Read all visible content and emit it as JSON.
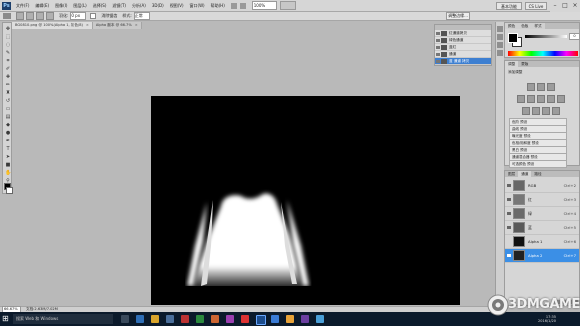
{
  "menubar": {
    "items": [
      "文件(F)",
      "编辑(E)",
      "图像(I)",
      "图层(L)",
      "选择(S)",
      "滤镜(T)",
      "分析(A)",
      "3D(D)",
      "视图(V)",
      "窗口(W)",
      "帮助(H)"
    ],
    "zoom": "100%",
    "workspace_button": "基本功能",
    "cs_live": "CS Live"
  },
  "options": {
    "feather_label": "羽化:",
    "feather_value": "0 px",
    "antialias_label": "消除锯齿",
    "style_label": "样式:",
    "style_value": "正常",
    "refine_button": "调整边缘..."
  },
  "tabs": [
    {
      "label": "BG0810.png @ 100%(Alpha 1, 灰色/8)",
      "close": "×"
    },
    {
      "label": "Alpha 副本 @ 66.7%",
      "close": "×"
    }
  ],
  "status": {
    "zoom": "66.67%",
    "doc": "文档:2.63M/7.02M"
  },
  "channels": {
    "rows": [
      {
        "label": "红通道拷贝"
      },
      {
        "label": "绿色通道"
      },
      {
        "label": "蓝红"
      },
      {
        "label": "通道"
      },
      {
        "label": "蓝 通道 拷贝"
      }
    ]
  },
  "color_panel": {
    "tabs": [
      "颜色",
      "色板",
      "样式"
    ],
    "value": "0"
  },
  "adjustments": {
    "tabs": [
      "调整",
      "蒙版"
    ],
    "title": "添加调整",
    "presets": [
      "色阶 预设",
      "曲线 预设",
      "曝光度 预设",
      "色相/饱和度 预设",
      "黑白 预设",
      "通道混合器 预设",
      "可选颜色 预设"
    ]
  },
  "layers": {
    "tabs": [
      "图层",
      "通道",
      "路径"
    ],
    "rows": [
      {
        "name": "RGB",
        "shortcut": "Ctrl+2"
      },
      {
        "name": "红",
        "shortcut": "Ctrl+3"
      },
      {
        "name": "绿",
        "shortcut": "Ctrl+4"
      },
      {
        "name": "蓝",
        "shortcut": "Ctrl+5"
      },
      {
        "name": "Alpha 1",
        "shortcut": "Ctrl+6"
      },
      {
        "name": "Alpha 2",
        "shortcut": "Ctrl+7"
      }
    ]
  },
  "taskbar": {
    "search_placeholder": "搜索 Web 和 Windows",
    "time": "17:35",
    "date": "2016/1/20"
  },
  "watermark": "3DMGAME",
  "colors": {
    "selection": "#3b8fe6",
    "taskbar": "#0b1a2b",
    "canvas": "#000000"
  }
}
